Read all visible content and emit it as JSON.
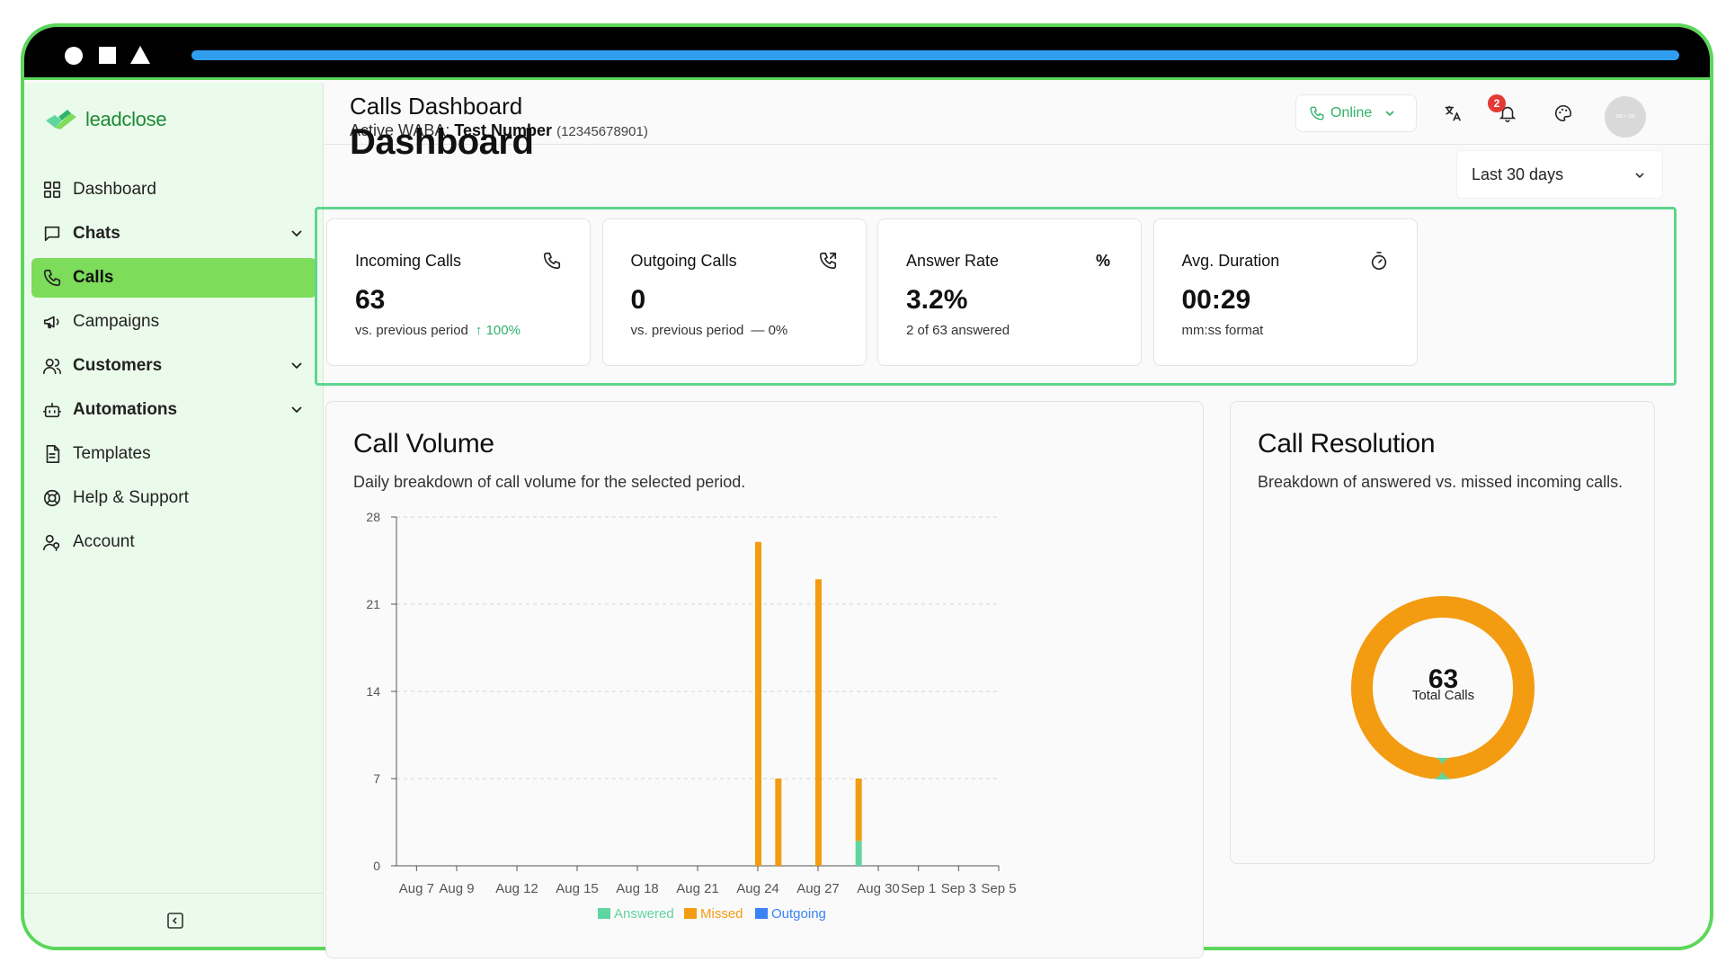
{
  "app": {
    "logo_text": "leadclose",
    "colors": {
      "accent": "#7ddc5a",
      "frame": "#5cd65a",
      "answered": "#5fd6a0",
      "missed": "#f39c12",
      "outgoing": "#3b82f6",
      "online": "#2fb36a",
      "badge": "#e53935"
    }
  },
  "sidebar": {
    "items": [
      {
        "label": "Dashboard",
        "icon": "grid-icon",
        "expandable": false,
        "active": false,
        "bold": false
      },
      {
        "label": "Chats",
        "icon": "chat-icon",
        "expandable": true,
        "active": false,
        "bold": true
      },
      {
        "label": "Calls",
        "icon": "phone-icon",
        "expandable": false,
        "active": true,
        "bold": true
      },
      {
        "label": "Campaigns",
        "icon": "megaphone-icon",
        "expandable": false,
        "active": false,
        "bold": false
      },
      {
        "label": "Customers",
        "icon": "users-icon",
        "expandable": true,
        "active": false,
        "bold": true
      },
      {
        "label": "Automations",
        "icon": "bot-icon",
        "expandable": true,
        "active": false,
        "bold": true
      },
      {
        "label": "Templates",
        "icon": "file-icon",
        "expandable": false,
        "active": false,
        "bold": false
      },
      {
        "label": "Help & Support",
        "icon": "lifebuoy-icon",
        "expandable": false,
        "active": false,
        "bold": false
      },
      {
        "label": "Account",
        "icon": "user-icon",
        "expandable": false,
        "active": false,
        "bold": false
      }
    ]
  },
  "header": {
    "title": "Calls Dashboard",
    "waba_label": "Active WABA:",
    "waba_name": "Test Number",
    "waba_number": "(12345678901)",
    "status": "Online",
    "notification_count": "2",
    "avatar_text": "100 × 100"
  },
  "main": {
    "title": "Dashboard",
    "range": "Last 30 days",
    "stats": [
      {
        "label": "Incoming Calls",
        "value": "63",
        "note": "vs. previous period",
        "change": "↑ 100%",
        "change_type": "up",
        "icon": "phone-incoming-icon"
      },
      {
        "label": "Outgoing Calls",
        "value": "0",
        "note": "vs. previous period",
        "change": "— 0%",
        "change_type": "flat",
        "icon": "phone-outgoing-icon"
      },
      {
        "label": "Answer Rate",
        "value": "3.2%",
        "note": "2 of 63 answered",
        "change": "",
        "change_type": "none",
        "icon": "percent-icon"
      },
      {
        "label": "Avg. Duration",
        "value": "00:29",
        "note": "mm:ss format",
        "change": "",
        "change_type": "none",
        "icon": "timer-icon"
      }
    ],
    "call_volume": {
      "title": "Call Volume",
      "description": "Daily breakdown of call volume for the selected period."
    },
    "call_resolution": {
      "title": "Call Resolution",
      "description": "Breakdown of answered vs. missed incoming calls.",
      "total": "63",
      "total_label": "Total Calls"
    }
  },
  "chart_data": [
    {
      "type": "bar",
      "stacked": true,
      "title": "Call Volume",
      "x_ticks": [
        "Aug 7",
        "Aug 9",
        "Aug 12",
        "Aug 15",
        "Aug 18",
        "Aug 21",
        "Aug 24",
        "Aug 27",
        "Aug 30",
        "Sep 1",
        "Sep 3",
        "Sep 5"
      ],
      "x_start": "Aug 6",
      "x_end": "Sep 5",
      "y_ticks": [
        0,
        7,
        14,
        21,
        28
      ],
      "ylim": [
        0,
        28
      ],
      "grid": true,
      "legend_position": "bottom",
      "series": [
        {
          "name": "Answered",
          "color": "#5fd6a0",
          "points": [
            {
              "x": "Aug 29",
              "y": 2
            }
          ]
        },
        {
          "name": "Missed",
          "color": "#f39c12",
          "points": [
            {
              "x": "Aug 24",
              "y": 26
            },
            {
              "x": "Aug 25",
              "y": 7
            },
            {
              "x": "Aug 27",
              "y": 23
            },
            {
              "x": "Aug 29",
              "y": 5
            }
          ]
        },
        {
          "name": "Outgoing",
          "color": "#3b82f6",
          "points": []
        }
      ]
    },
    {
      "type": "pie",
      "donut": true,
      "title": "Call Resolution",
      "series": [
        {
          "name": "Answered",
          "value": 2,
          "color": "#5fd6a0"
        },
        {
          "name": "Missed",
          "value": 61,
          "color": "#f39c12"
        }
      ]
    }
  ]
}
